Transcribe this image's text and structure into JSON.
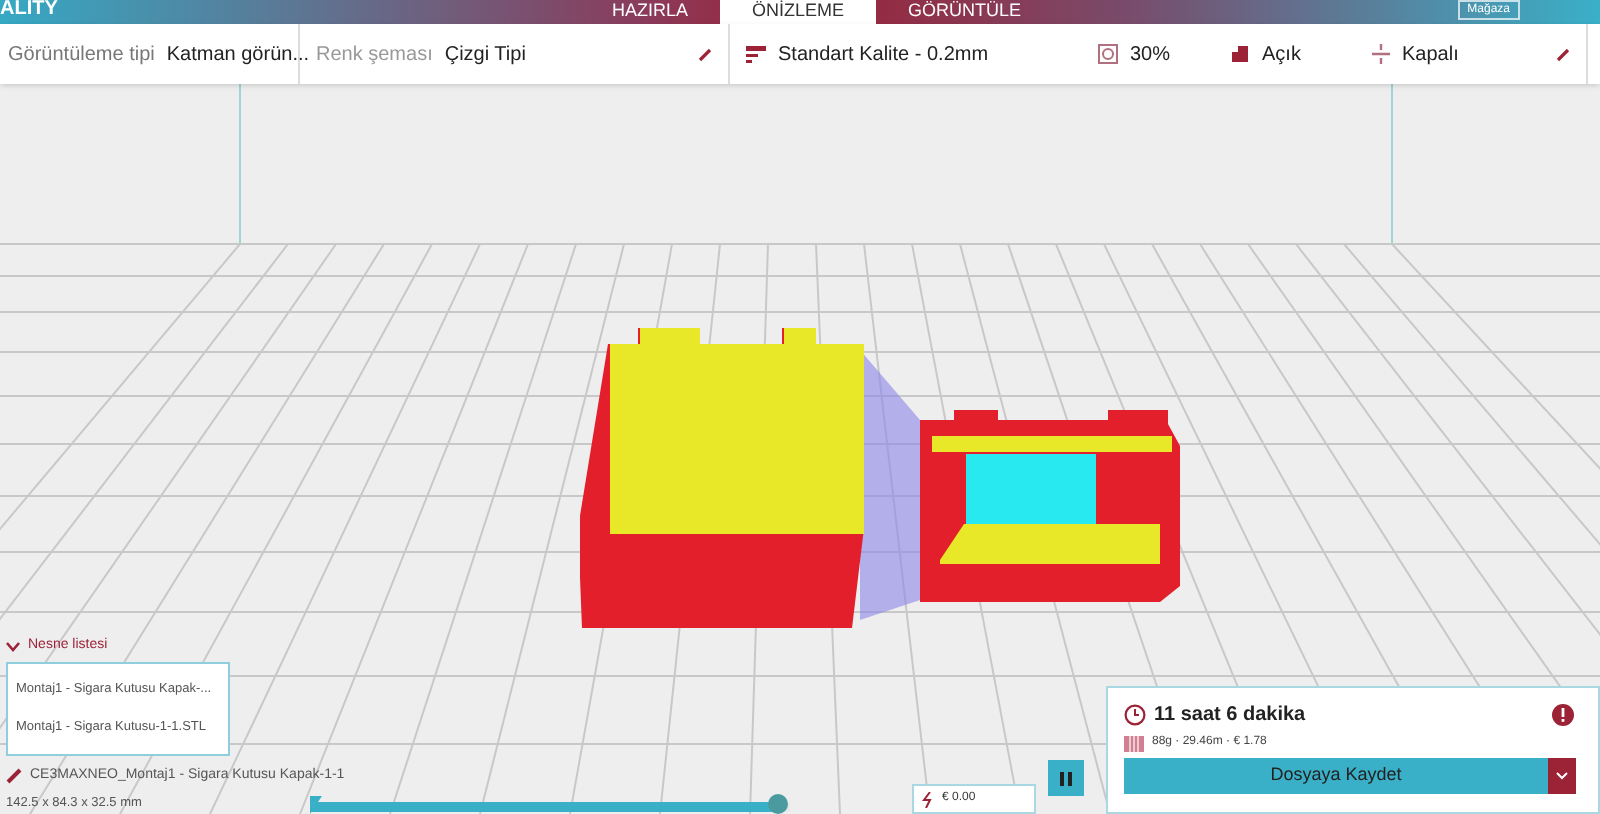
{
  "header": {
    "logo": "ALITY",
    "tabs": [
      {
        "label": "HAZIRLA",
        "selected": false
      },
      {
        "label": "ÖNİZLEME",
        "selected": true
      },
      {
        "label": "GÖRÜNTÜLE",
        "selected": false
      }
    ],
    "buttons": [
      "Mağaza"
    ]
  },
  "toolbar": {
    "view_type": {
      "label": "Görüntüleme tipi",
      "value": "Katman görün..."
    },
    "color_scheme": {
      "label": "Renk şeması",
      "value": "Çizgi Tipi"
    },
    "profile": "Standart Kalite - 0.2mm",
    "infill": "30%",
    "support": "Açık",
    "adhesion": "Kapalı"
  },
  "object_list": {
    "title": "Nesne listesi",
    "expanded": true,
    "items": [
      {
        "label": "Montaj1 - Sigara Kutusu Kapak-...",
        "selected": false
      },
      {
        "label": "Montaj1 - Sigara Kutusu-1-1.STL",
        "selected": false
      }
    ],
    "current": "CE3MAXNEO_Montaj1 - Sigara Kutusu Kapak-1-1",
    "dimensions": "142.5 x 84.3 x 32.5 mm"
  },
  "layer_slider": {
    "level": 0.98
  },
  "cost": "€ 0.00",
  "print_panel": {
    "time": "11 saat 6 dakika",
    "material": "88g · 29.46m · € 1.78",
    "save_button": "Dosyaya Kaydet"
  }
}
